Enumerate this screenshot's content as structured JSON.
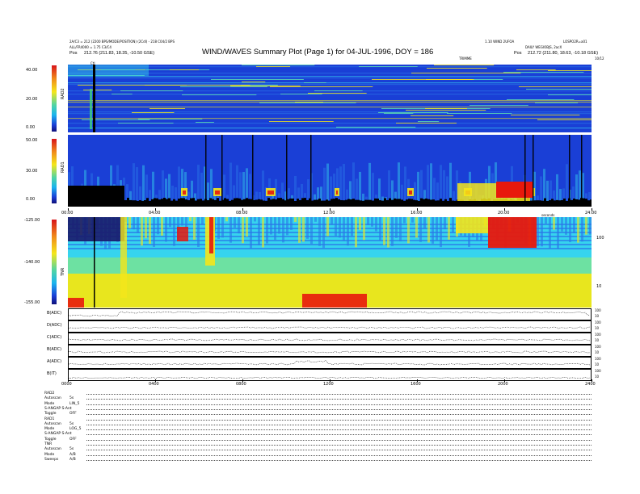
{
  "header": {
    "title": "WIND/WAVES Summary Plot (Page 1) for 04-JUL-1996, DOY = 186",
    "left_line1": "2A/C3 = 212 (2200 BPS/MODE/POSITION) (2Cdl) - 218 C04/2 BPS",
    "left_line2": "ALL/FR4000 = 1.75 C3/C4",
    "left_pos_label": "Pos",
    "left_pos": "212.76 (211.83, 18.35, -10.50 GSE)",
    "right_line1": "1.10 WIND 2UFOA",
    "right_line2": "DAILY WEGIOBJS, 2acX",
    "right_version": "LOSPO2R=a01",
    "right_pos_label": "Pos",
    "right_pos": "212.72 (211.80, 18.63, -10.18 GSE)",
    "trim_label": "TRIMME",
    "ctrl_label": "CtI",
    "colorbar_range": "10/12"
  },
  "panels": {
    "rad2": {
      "axis_label": "RAD2",
      "ticks": [
        "40.00",
        "20.00",
        "0.00"
      ]
    },
    "rad1": {
      "axis_label": "RAD1",
      "ticks": [
        "50.00",
        "30.00",
        "0.00"
      ]
    },
    "tnr": {
      "axis_label": "TNR",
      "ticks": [
        "-125.00",
        "-140.00",
        "-155.00"
      ],
      "right_ticks": [
        "100",
        "10"
      ]
    },
    "time_ticks_mid": [
      "00:00",
      "04:00",
      "08:00",
      "12:00",
      "16:00",
      "20:00",
      "24:00"
    ],
    "time_ticks_bottom": [
      "0000",
      "0400",
      "0800",
      "1200",
      "1600",
      "2000",
      "2400"
    ],
    "mid_axis_label": "seconds",
    "bottom_axis_label": "hours"
  },
  "lines": [
    {
      "label": "B(ADC)",
      "right": [
        "100",
        "10"
      ]
    },
    {
      "label": "D(ADC)",
      "right": [
        "100",
        "10"
      ]
    },
    {
      "label": "C(ADC)",
      "right": [
        "100",
        "10"
      ]
    },
    {
      "label": "B(ADC)",
      "right": [
        "100",
        "10"
      ]
    },
    {
      "label": "A(ADC)",
      "right": [
        "100",
        "10"
      ]
    },
    {
      "label": "B(IT)",
      "right": [
        "100",
        "10"
      ]
    }
  ],
  "info_block": [
    {
      "name": "RAD2",
      "value": ""
    },
    {
      "name": "Autoscan",
      "value": "5s"
    },
    {
      "name": "Mode",
      "value": "LIN_5"
    },
    {
      "name": "S-ANGAP S-Ant",
      "value": ""
    },
    {
      "name": "Toggle",
      "value": "OFF"
    },
    {
      "name": "RAD1",
      "value": ""
    },
    {
      "name": "Autoscan",
      "value": "5s"
    },
    {
      "name": "Mode",
      "value": "LOG_5"
    },
    {
      "name": "S-ANGAP S-Ant",
      "value": ""
    },
    {
      "name": "Toggle",
      "value": "OFF"
    },
    {
      "name": "TNR",
      "value": ""
    },
    {
      "name": "Autoscan",
      "value": "5s"
    },
    {
      "name": "Mode",
      "value": "A/B"
    },
    {
      "name": "Sweeps",
      "value": "A/B"
    }
  ],
  "colors": {
    "spectrum_bg": "#1a3fd6",
    "rad_low": "#000000",
    "burst_red": "#e8180c",
    "tnr_yellow": "#e8e61e",
    "tnr_cyan": "#36d4ee"
  }
}
